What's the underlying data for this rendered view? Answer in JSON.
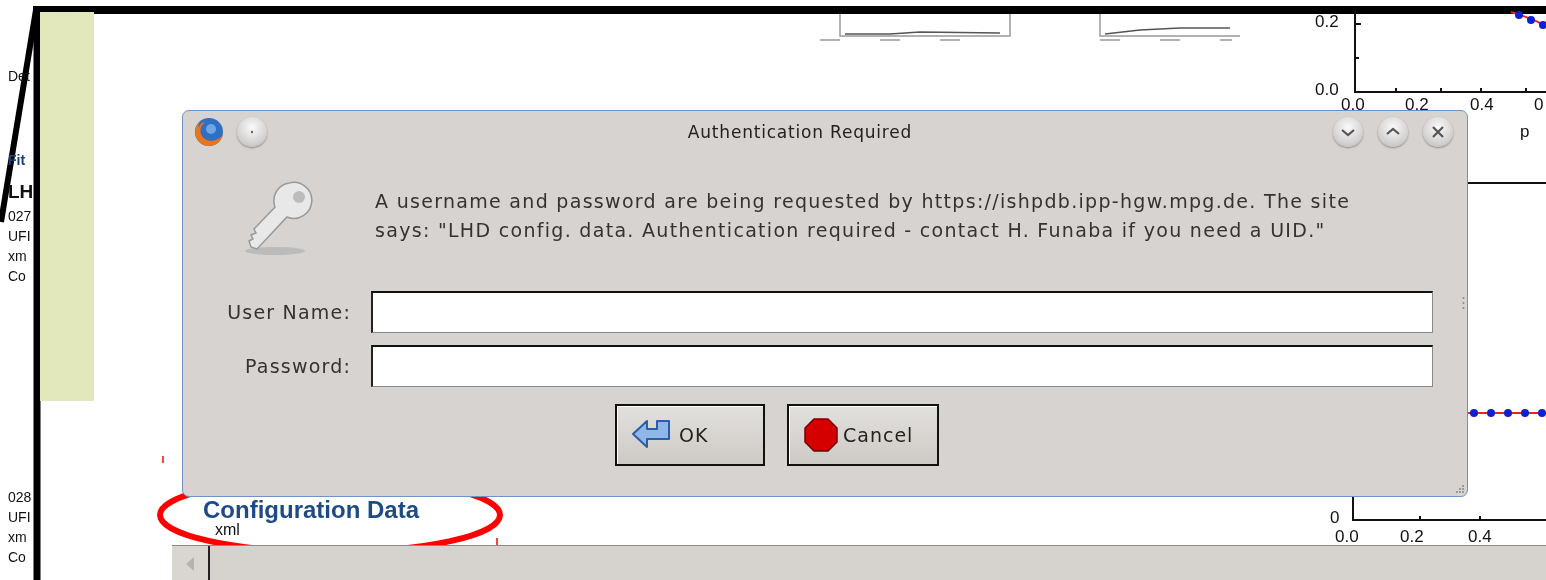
{
  "page": {
    "left_column": [
      {
        "items": [
          {
            "text": "Det",
            "kind": "plain"
          },
          {
            "text": "Fit",
            "kind": "link"
          },
          {
            "text": "LH",
            "kind": "heading"
          },
          {
            "text": "027",
            "kind": "plain"
          },
          {
            "text": "UFI",
            "kind": "plain"
          },
          {
            "text": "xm",
            "kind": "plain"
          },
          {
            "text": "Co",
            "kind": "plain"
          }
        ]
      },
      {
        "items": [
          {
            "text": "028",
            "kind": "plain"
          },
          {
            "text": "UFI",
            "kind": "plain"
          },
          {
            "text": "xm",
            "kind": "plain"
          },
          {
            "text": "Co",
            "kind": "plain"
          }
        ]
      }
    ],
    "section_heading": "Configuration Data",
    "section_format": "xml",
    "plots": [
      {
        "y_ticks": [
          "0.2",
          "0.0"
        ],
        "x_ticks": [
          "0.0",
          "0.2",
          "0.4",
          "0"
        ],
        "x_label": "p"
      },
      {
        "y_ticks": [
          "0"
        ],
        "x_ticks": [
          "0.0",
          "0.2",
          "0.4"
        ]
      }
    ]
  },
  "dialog": {
    "title": "Authentication Required",
    "message": "A username and password are being requested by https://ishpdb.ipp-hgw.mpg.de. The site says: \"LHD config. data. Authentication required - contact H. Funaba if you need a UID.\"",
    "fields": [
      {
        "label": "User Name:"
      },
      {
        "label": "Password:"
      }
    ],
    "buttons": [
      {
        "label": "OK",
        "kind": "ok"
      },
      {
        "label": "Cancel",
        "kind": "cancel"
      }
    ]
  }
}
